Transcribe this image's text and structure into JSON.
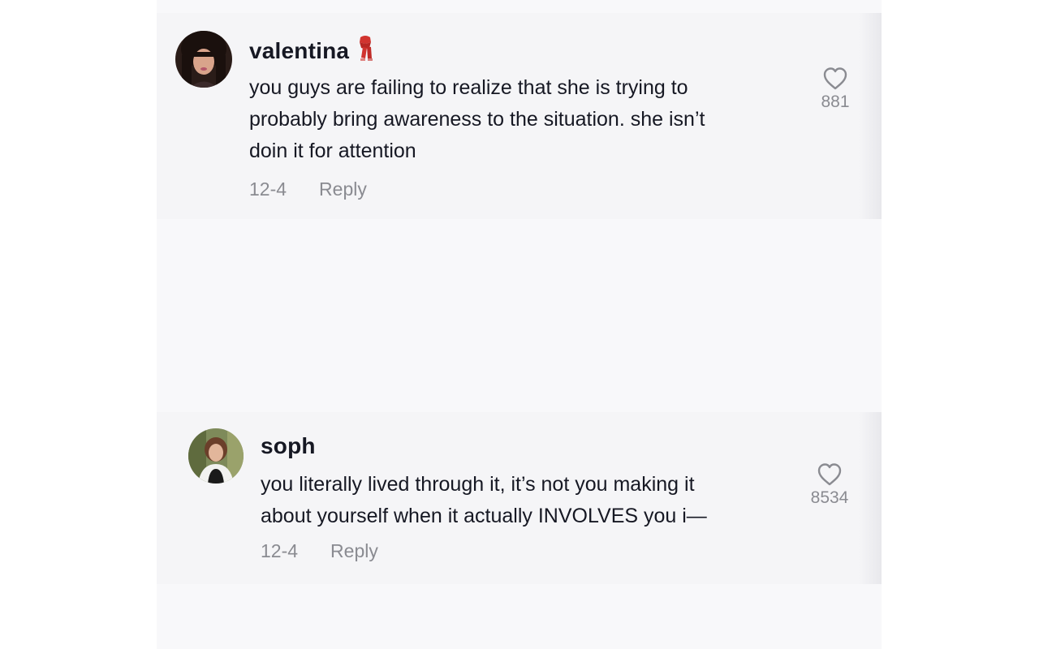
{
  "comments": [
    {
      "username": "valentina",
      "username_emoji": "scarf-icon",
      "text_lines": [
        "you guys are failing to realize that she is trying to",
        "probably bring awareness to the situation. she isn’t",
        "doin it for attention"
      ],
      "date": "12-4",
      "reply_label": "Reply",
      "likes": "881"
    },
    {
      "username": "soph",
      "text_lines": [
        "you literally lived through it, it’s not you making it",
        "about yourself when it actually INVOLVES you i—"
      ],
      "date": "12-4",
      "reply_label": "Reply",
      "likes": "8534"
    }
  ],
  "colors": {
    "text_primary": "#161823",
    "text_secondary": "#8a8b91",
    "card_bg": "#f5f5f7",
    "screen_bg": "#f8f8fa"
  }
}
